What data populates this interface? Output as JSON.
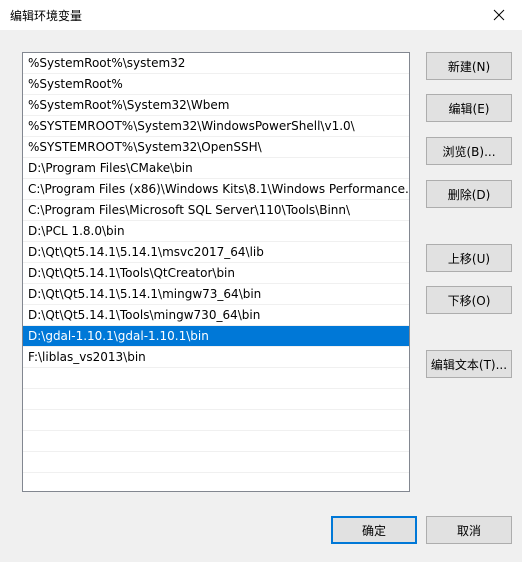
{
  "window": {
    "title": "编辑环境变量"
  },
  "list": {
    "items": [
      {
        "text": "%SystemRoot%\\system32",
        "selected": false
      },
      {
        "text": "%SystemRoot%",
        "selected": false
      },
      {
        "text": "%SystemRoot%\\System32\\Wbem",
        "selected": false
      },
      {
        "text": "%SYSTEMROOT%\\System32\\WindowsPowerShell\\v1.0\\",
        "selected": false
      },
      {
        "text": "%SYSTEMROOT%\\System32\\OpenSSH\\",
        "selected": false
      },
      {
        "text": "D:\\Program Files\\CMake\\bin",
        "selected": false
      },
      {
        "text": "C:\\Program Files (x86)\\Windows Kits\\8.1\\Windows Performance...",
        "selected": false
      },
      {
        "text": "C:\\Program Files\\Microsoft SQL Server\\110\\Tools\\Binn\\",
        "selected": false
      },
      {
        "text": "D:\\PCL 1.8.0\\bin",
        "selected": false
      },
      {
        "text": "D:\\Qt\\Qt5.14.1\\5.14.1\\msvc2017_64\\lib",
        "selected": false
      },
      {
        "text": "D:\\Qt\\Qt5.14.1\\Tools\\QtCreator\\bin",
        "selected": false
      },
      {
        "text": "D:\\Qt\\Qt5.14.1\\5.14.1\\mingw73_64\\bin",
        "selected": false
      },
      {
        "text": "D:\\Qt\\Qt5.14.1\\Tools\\mingw730_64\\bin",
        "selected": false
      },
      {
        "text": "D:\\gdal-1.10.1\\gdal-1.10.1\\bin",
        "selected": true
      },
      {
        "text": "F:\\liblas_vs2013\\bin",
        "selected": false
      },
      {
        "text": "",
        "selected": false
      },
      {
        "text": "",
        "selected": false
      },
      {
        "text": "",
        "selected": false
      },
      {
        "text": "",
        "selected": false
      },
      {
        "text": "",
        "selected": false
      },
      {
        "text": "",
        "selected": false
      }
    ]
  },
  "buttons": {
    "new": "新建(N)",
    "edit": "编辑(E)",
    "browse": "浏览(B)...",
    "delete": "删除(D)",
    "move_up": "上移(U)",
    "move_down": "下移(O)",
    "edit_text": "编辑文本(T)...",
    "ok": "确定",
    "cancel": "取消"
  },
  "colors": {
    "selection": "#0078d7",
    "dialog_bg": "#f0f0f0",
    "button_bg": "#e1e1e1"
  }
}
